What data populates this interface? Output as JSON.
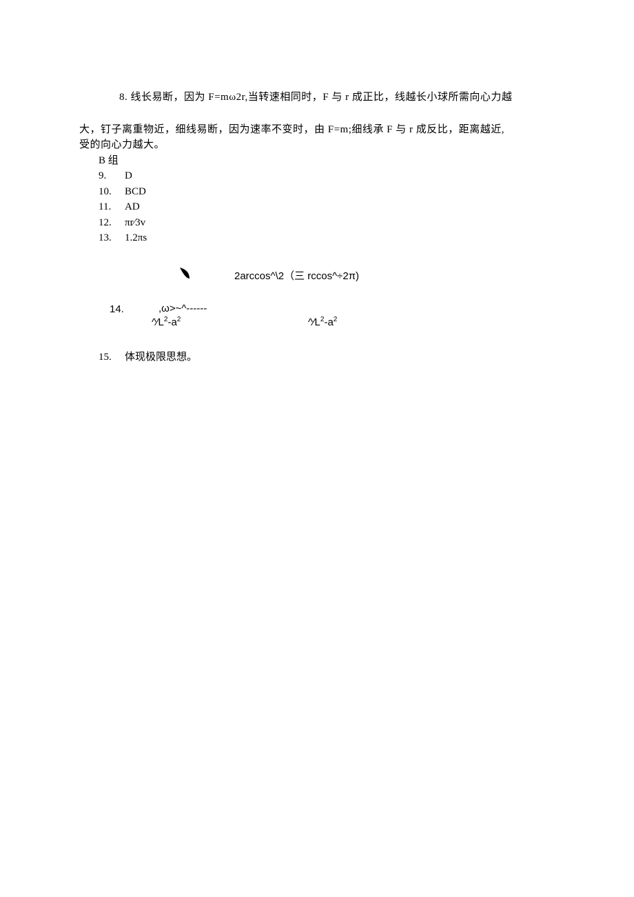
{
  "q8": {
    "num": "8.",
    "line1": "线长易断，因为 F=mω2r,当转速相同时，F 与 r 成正比，线越长小球所需向心力越",
    "line2": "大，钉子离重物近，细线易断，因为速率不变时，由 F=m;细线承   F 与 r 成反比，距离越近,",
    "line3": "受的向心力越大。"
  },
  "groupB": "B 组",
  "q9": {
    "num": "9.",
    "ans": "D"
  },
  "q10": {
    "num": "10.",
    "ans": "BCD"
  },
  "q11": {
    "num": "11.",
    "ans": "AD"
  },
  "q12": {
    "num": "12.",
    "ans": "πr∕3v"
  },
  "q13": {
    "num": "13.",
    "ans": "1.2πs"
  },
  "q14": {
    "num": "14.",
    "top_formula": "2arccos^\\2（三 rccos^÷2π)",
    "omega_frag": ",ω>~^------",
    "denom": "^∕L",
    "denom_exp": "2",
    "denom_rest": "-a",
    "denom_exp2": "2"
  },
  "q15": {
    "num": "15.",
    "ans": "体现极限思想。"
  }
}
